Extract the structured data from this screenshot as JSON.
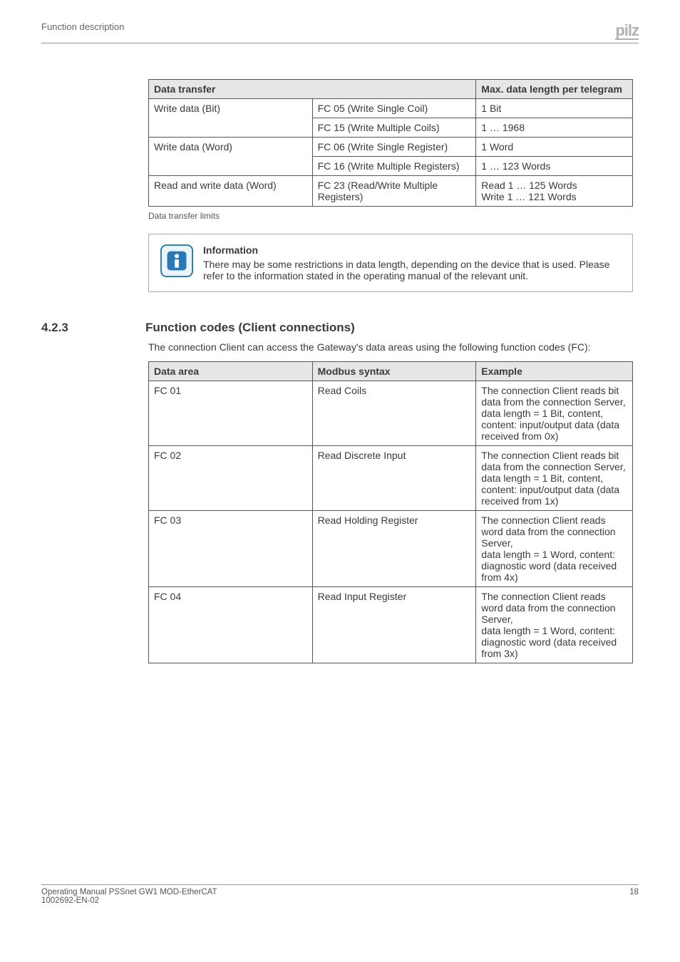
{
  "header": {
    "section_path": "Function description"
  },
  "logo_text": "pilz",
  "table1": {
    "h1": "Data transfer",
    "h2": "Max. data length per telegram",
    "rows": [
      {
        "c1": "Write data (Bit)",
        "c2": "FC 05 (Write Single Coil)",
        "c3": "1 Bit"
      },
      {
        "c1": "",
        "c2": "FC 15 (Write Multiple Coils)",
        "c3": "1 … 1968"
      },
      {
        "c1": "Write data (Word)",
        "c2": "FC 06 (Write Single Register)",
        "c3": "1 Word"
      },
      {
        "c1": "",
        "c2": "FC 16 (Write Multiple Registers)",
        "c3": "1 … 123 Words"
      },
      {
        "c1": "Read and write data (Word)",
        "c2": "FC 23 (Read/Write Multiple Registers)",
        "c3": "Read 1 … 125 Words\nWrite 1 … 121 Words"
      }
    ],
    "caption": "Data transfer limits"
  },
  "info": {
    "title": "Information",
    "body": "There may be some restrictions in data length, depending on the device that is used. Please refer to the information stated in the operating manual of the relevant unit."
  },
  "section": {
    "num": "4.2.3",
    "title": "Function codes (Client connections)",
    "para": "The connection Client can access the Gateway's data areas using the following function codes (FC):"
  },
  "table2": {
    "h1": "Data area",
    "h2": "Modbus syntax",
    "h3": "Example",
    "rows": [
      {
        "c1": "FC 01",
        "c2": "Read Coils",
        "c3": "The connection Client reads bit data from the connection Server,\ndata length = 1 Bit, content, content: input/output data (data received from 0x)"
      },
      {
        "c1": "FC 02",
        "c2": "Read Discrete Input",
        "c3": "The connection Client reads bit data from the connection Server,\ndata length = 1 Bit, content, content: input/output data (data received from 1x)"
      },
      {
        "c1": "FC 03",
        "c2": "Read Holding Register",
        "c3": "The connection Client reads word data from the connection Server,\ndata length = 1 Word, content: diagnostic word (data received from 4x)"
      },
      {
        "c1": "FC 04",
        "c2": "Read Input Register",
        "c3": "The connection Client reads word data from the connection Server,\ndata length = 1 Word, content: diagnostic word (data received from 3x)"
      }
    ]
  },
  "footer": {
    "left1": "Operating Manual PSSnet GW1 MOD-EtherCAT",
    "left2": "1002692-EN-02",
    "pagenum": "18"
  }
}
